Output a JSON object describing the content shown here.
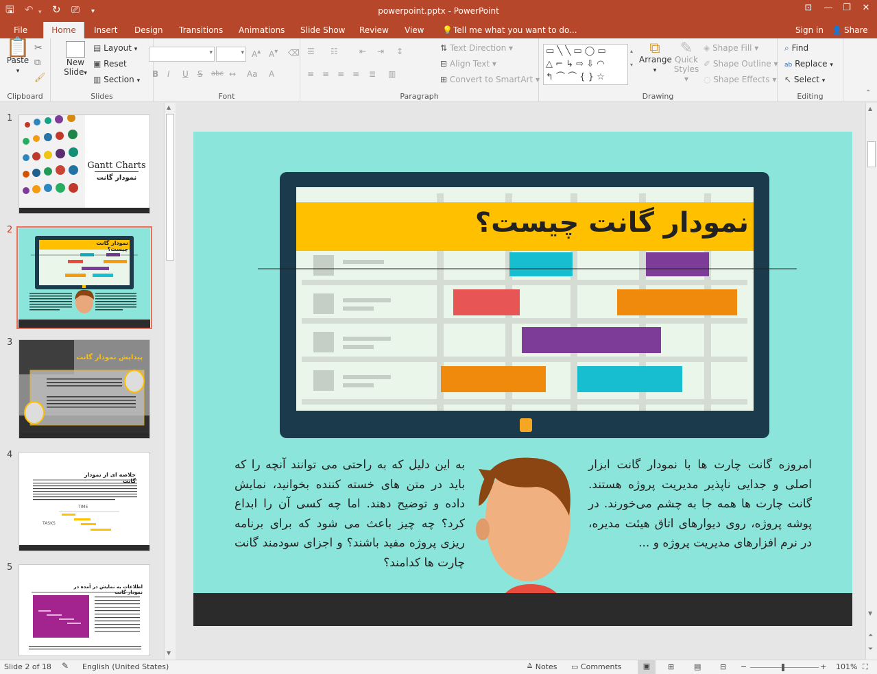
{
  "window": {
    "title": "powerpoint.pptx - PowerPoint"
  },
  "tabs": [
    "File",
    "Home",
    "Insert",
    "Design",
    "Transitions",
    "Animations",
    "Slide Show",
    "Review",
    "View"
  ],
  "tell_me": "Tell me what you want to do...",
  "account": {
    "sign_in": "Sign in",
    "share": "Share"
  },
  "ribbon": {
    "clipboard": {
      "label": "Clipboard",
      "paste": "Paste"
    },
    "slides": {
      "label": "Slides",
      "new_slide": "New",
      "new_slide2": "Slide",
      "layout": "Layout",
      "reset": "Reset",
      "section": "Section"
    },
    "font": {
      "label": "Font",
      "bold": "B",
      "italic": "I",
      "underline": "U",
      "strike": "S",
      "shadow": "abc"
    },
    "paragraph": {
      "label": "Paragraph",
      "text_direction": "Text Direction",
      "align_text": "Align Text",
      "smartart": "Convert to SmartArt"
    },
    "drawing": {
      "label": "Drawing",
      "arrange": "Arrange",
      "quick1": "Quick",
      "quick2": "Styles",
      "shape_fill": "Shape Fill",
      "shape_outline": "Shape Outline",
      "shape_effects": "Shape Effects"
    },
    "editing": {
      "label": "Editing",
      "find": "Find",
      "replace": "Replace",
      "select": "Select"
    }
  },
  "thumbnails": [
    {
      "num": "1",
      "title_en": "Gantt Charts",
      "title_fa": "نمودار گانت"
    },
    {
      "num": "2",
      "title_fa": "نمودار گانت چیست؟"
    },
    {
      "num": "3",
      "title_fa": "پیدایش نمودار گانت"
    },
    {
      "num": "4",
      "title_fa": "خلاصه ای از نمودار گانت",
      "time": "TIME",
      "tasks": "TASKS"
    },
    {
      "num": "5",
      "title_fa": "اطلاعات به نمایش در آمده در نمودار گانت"
    }
  ],
  "slide": {
    "title": "نمودار گانت چیست؟",
    "text_right": "امروزه گانت چارت ها با نمودار گانت ابزار اصلی و جدایی ناپذیر مدیریت پروژه هستند. گانت چارت ها همه جا به چشم می‌خورند. در پوشه پروژه، روی دیوارهای اتاق هیئت مدیره، در نرم افزارهای مدیریت پروژه و ...",
    "text_left": "به این دلیل که به راحتی می توانند آنچه را که باید در متن های خسته کننده بخوانید، نمایش داده و توضیح دهند. اما چه کسی آن را ابداع کرد؟ چه چیز باعث می شود که برای برنامه ریزی پروژه مفید باشند؟ و اجزای سودمند گانت چارت ها کدامند؟"
  },
  "status": {
    "slide": "Slide 2 of 18",
    "language": "English (United States)",
    "notes": "Notes",
    "comments": "Comments",
    "zoom": "101%"
  },
  "colors": {
    "accent": "#b7472a",
    "slide_bg": "#8ce5da",
    "banner": "#ffc000",
    "monitor": "#1b3a4b"
  }
}
